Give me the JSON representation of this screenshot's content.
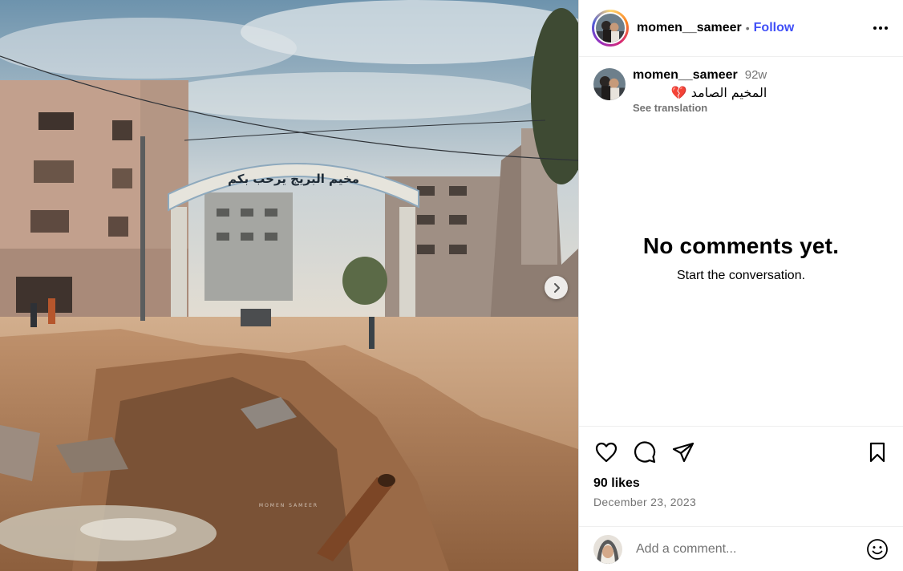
{
  "post": {
    "author": {
      "username": "momen__sameer",
      "separator": "•",
      "follow_label": "Follow"
    },
    "caption": {
      "username": "momen__sameer",
      "age": "92w",
      "text": "المخيم الصامد 💔",
      "translate_label": "See translation"
    },
    "photo": {
      "arch_text": "مخيم البريج يرحب بكم",
      "watermark": "MOMEN SAMEER"
    },
    "comments": {
      "empty_title": "No comments yet.",
      "empty_subtitle": "Start the conversation."
    },
    "likes": "90 likes",
    "date": "December 23, 2023",
    "comment_input": {
      "placeholder": "Add a comment..."
    },
    "icons": {
      "more": "more-options-icon",
      "like": "heart-icon",
      "comment": "comment-bubble-icon",
      "share": "paper-plane-icon",
      "save": "bookmark-icon",
      "next": "chevron-right-icon",
      "emoji": "emoji-icon"
    },
    "colors": {
      "follow": "#4150f7",
      "secondary_text": "#737373",
      "border": "#dbdbdb"
    }
  }
}
